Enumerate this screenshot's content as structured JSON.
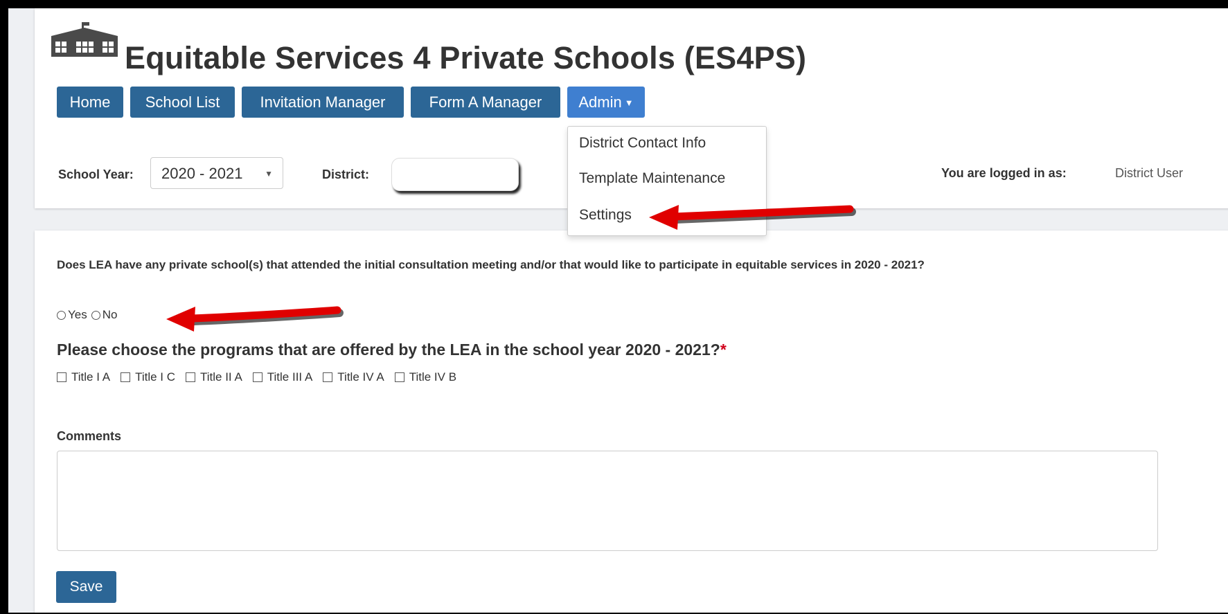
{
  "app": {
    "title": "Equitable Services 4 Private Schools (ES4PS)"
  },
  "nav": {
    "items": [
      {
        "label": "Home"
      },
      {
        "label": "School List"
      },
      {
        "label": "Invitation Manager"
      },
      {
        "label": "Form A Manager"
      },
      {
        "label": "Admin"
      }
    ],
    "admin_dropdown": [
      {
        "label": "District Contact Info"
      },
      {
        "label": "Template Maintenance"
      },
      {
        "label": "Settings"
      }
    ]
  },
  "filters": {
    "school_year_label": "School Year:",
    "school_year_value": "2020 - 2021",
    "district_label": "District:",
    "district_value": ""
  },
  "user": {
    "logged_in_label": "You are logged in as:",
    "name": "District User"
  },
  "form": {
    "question": "Does LEA have any private school(s) that attended the initial consultation meeting and/or that would like to participate in equitable services in 2020 - 2021?",
    "yes_label": "Yes",
    "no_label": "No",
    "programs_question": "Please choose the programs that are offered by the LEA in the school year 2020 - 2021?",
    "required_mark": "*",
    "programs": [
      {
        "label": "Title I A"
      },
      {
        "label": "Title I C"
      },
      {
        "label": "Title II A"
      },
      {
        "label": "Title III A"
      },
      {
        "label": "Title IV A"
      },
      {
        "label": "Title IV B"
      }
    ],
    "comments_label": "Comments",
    "comments_value": "",
    "save_label": "Save"
  },
  "colors": {
    "primary": "#2c6696",
    "active": "#3f7fd0",
    "annotation_arrow": "#e00000"
  }
}
